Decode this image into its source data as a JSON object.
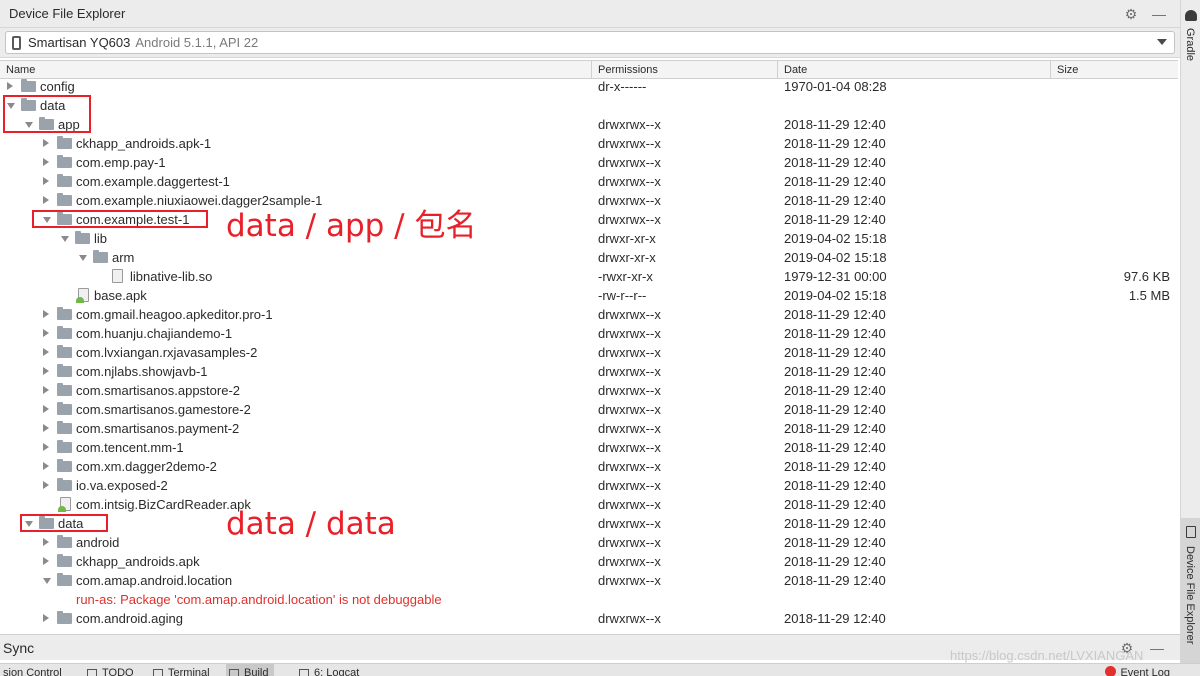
{
  "window": {
    "title": "Device File Explorer"
  },
  "toolbar_icons": [
    "gear-icon",
    "minimize-icon"
  ],
  "device": {
    "name": "Smartisan YQ603",
    "version": "Android 5.1.1, API 22"
  },
  "columns": {
    "name": "Name",
    "permissions": "Permissions",
    "date": "Date",
    "size": "Size"
  },
  "rows": [
    {
      "name": "config",
      "type": "folder",
      "depth": 0,
      "state": "collapsed",
      "perm": "dr-x------",
      "date": "1970-01-04 08:28",
      "size": ""
    },
    {
      "name": "data",
      "type": "folder",
      "depth": 0,
      "state": "expanded",
      "perm": "",
      "date": "",
      "size": ""
    },
    {
      "name": "app",
      "type": "folder",
      "depth": 1,
      "state": "expanded",
      "perm": "drwxrwx--x",
      "date": "2018-11-29 12:40",
      "size": ""
    },
    {
      "name": "ckhapp_androids.apk-1",
      "type": "folder",
      "depth": 2,
      "state": "collapsed",
      "perm": "drwxrwx--x",
      "date": "2018-11-29 12:40",
      "size": ""
    },
    {
      "name": "com.emp.pay-1",
      "type": "folder",
      "depth": 2,
      "state": "collapsed",
      "perm": "drwxrwx--x",
      "date": "2018-11-29 12:40",
      "size": ""
    },
    {
      "name": "com.example.daggertest-1",
      "type": "folder",
      "depth": 2,
      "state": "collapsed",
      "perm": "drwxrwx--x",
      "date": "2018-11-29 12:40",
      "size": ""
    },
    {
      "name": "com.example.niuxiaowei.dagger2sample-1",
      "type": "folder",
      "depth": 2,
      "state": "collapsed",
      "perm": "drwxrwx--x",
      "date": "2018-11-29 12:40",
      "size": ""
    },
    {
      "name": "com.example.test-1",
      "type": "folder",
      "depth": 2,
      "state": "expanded",
      "perm": "drwxrwx--x",
      "date": "2018-11-29 12:40",
      "size": ""
    },
    {
      "name": "lib",
      "type": "folder",
      "depth": 3,
      "state": "expanded",
      "perm": "drwxr-xr-x",
      "date": "2019-04-02 15:18",
      "size": ""
    },
    {
      "name": "arm",
      "type": "folder",
      "depth": 4,
      "state": "expanded",
      "perm": "drwxr-xr-x",
      "date": "2019-04-02 15:18",
      "size": ""
    },
    {
      "name": "libnative-lib.so",
      "type": "file",
      "depth": 5,
      "state": "none",
      "perm": "-rwxr-xr-x",
      "date": "1979-12-31 00:00",
      "size": "97.6 KB"
    },
    {
      "name": "base.apk",
      "type": "apk",
      "depth": 3,
      "state": "none",
      "perm": "-rw-r--r--",
      "date": "2019-04-02 15:18",
      "size": "1.5 MB"
    },
    {
      "name": "com.gmail.heagoo.apkeditor.pro-1",
      "type": "folder",
      "depth": 2,
      "state": "collapsed",
      "perm": "drwxrwx--x",
      "date": "2018-11-29 12:40",
      "size": ""
    },
    {
      "name": "com.huanju.chajiandemo-1",
      "type": "folder",
      "depth": 2,
      "state": "collapsed",
      "perm": "drwxrwx--x",
      "date": "2018-11-29 12:40",
      "size": ""
    },
    {
      "name": "com.lvxiangan.rxjavasamples-2",
      "type": "folder",
      "depth": 2,
      "state": "collapsed",
      "perm": "drwxrwx--x",
      "date": "2018-11-29 12:40",
      "size": ""
    },
    {
      "name": "com.njlabs.showjavb-1",
      "type": "folder",
      "depth": 2,
      "state": "collapsed",
      "perm": "drwxrwx--x",
      "date": "2018-11-29 12:40",
      "size": ""
    },
    {
      "name": "com.smartisanos.appstore-2",
      "type": "folder",
      "depth": 2,
      "state": "collapsed",
      "perm": "drwxrwx--x",
      "date": "2018-11-29 12:40",
      "size": ""
    },
    {
      "name": "com.smartisanos.gamestore-2",
      "type": "folder",
      "depth": 2,
      "state": "collapsed",
      "perm": "drwxrwx--x",
      "date": "2018-11-29 12:40",
      "size": ""
    },
    {
      "name": "com.smartisanos.payment-2",
      "type": "folder",
      "depth": 2,
      "state": "collapsed",
      "perm": "drwxrwx--x",
      "date": "2018-11-29 12:40",
      "size": ""
    },
    {
      "name": "com.tencent.mm-1",
      "type": "folder",
      "depth": 2,
      "state": "collapsed",
      "perm": "drwxrwx--x",
      "date": "2018-11-29 12:40",
      "size": ""
    },
    {
      "name": "com.xm.dagger2demo-2",
      "type": "folder",
      "depth": 2,
      "state": "collapsed",
      "perm": "drwxrwx--x",
      "date": "2018-11-29 12:40",
      "size": ""
    },
    {
      "name": "io.va.exposed-2",
      "type": "folder",
      "depth": 2,
      "state": "collapsed",
      "perm": "drwxrwx--x",
      "date": "2018-11-29 12:40",
      "size": ""
    },
    {
      "name": "com.intsig.BizCardReader.apk",
      "type": "apk",
      "depth": 2,
      "state": "none",
      "perm": "drwxrwx--x",
      "date": "2018-11-29 12:40",
      "size": ""
    },
    {
      "name": "data",
      "type": "folder",
      "depth": 1,
      "state": "expanded",
      "perm": "drwxrwx--x",
      "date": "2018-11-29 12:40",
      "size": ""
    },
    {
      "name": "android",
      "type": "folder",
      "depth": 2,
      "state": "collapsed",
      "perm": "drwxrwx--x",
      "date": "2018-11-29 12:40",
      "size": ""
    },
    {
      "name": "ckhapp_androids.apk",
      "type": "folder",
      "depth": 2,
      "state": "collapsed",
      "perm": "drwxrwx--x",
      "date": "2018-11-29 12:40",
      "size": ""
    },
    {
      "name": "com.amap.android.location",
      "type": "folder",
      "depth": 2,
      "state": "expanded",
      "perm": "drwxrwx--x",
      "date": "2018-11-29 12:40",
      "size": ""
    },
    {
      "name": "run-as: Package 'com.amap.android.location' is not debuggable",
      "type": "error",
      "depth": 2,
      "state": "none",
      "perm": "",
      "date": "",
      "size": ""
    },
    {
      "name": "com.android.aging",
      "type": "folder",
      "depth": 2,
      "state": "collapsed",
      "perm": "drwxrwx--x",
      "date": "2018-11-29 12:40",
      "size": ""
    }
  ],
  "annotations": {
    "label_app": "data / app / 包名",
    "label_data": "data / data"
  },
  "right_stripe": {
    "gradle": "Gradle",
    "device_file_explorer": "Device File Explorer"
  },
  "sync": {
    "label": "Sync"
  },
  "bottom_tabs": [
    {
      "label": "sion Control",
      "active": false
    },
    {
      "label": "TODO",
      "active": false
    },
    {
      "label": "Terminal",
      "active": false
    },
    {
      "label": "Build",
      "active": true
    },
    {
      "label": "6: Logcat",
      "active": false
    }
  ],
  "event_log": "Event Log",
  "watermark": "https://blog.csdn.net/LVXIANGAN"
}
